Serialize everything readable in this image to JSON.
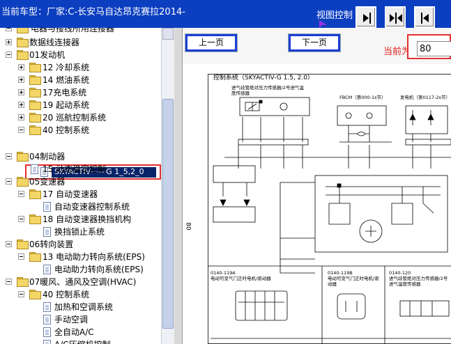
{
  "titlebar": {
    "title": "当前车型：厂家:C-长安马自达昂克赛拉2014-",
    "view_control_label": "视图控制",
    "colors": {
      "bar": "#0c3ec0",
      "arrow": "#9a30e0"
    }
  },
  "tree": {
    "row0_partial": "电器与接线所用连接器",
    "row1": "数据线连接器",
    "row2": "01发动机",
    "row3": "12 冷却系统",
    "row4": "14 燃油系统",
    "row5": "17充电系统",
    "row6": "19 起动系统",
    "row7": "20 巡航控制系统",
    "row8": "40 控制系统",
    "row9_selected": "SKYACTIV——G 1_5,2_0",
    "row10": "04制动器",
    "row11": "15 动态稳定控制",
    "row12": "05变速器",
    "row13": "17 自动变速器",
    "row14": "自动变速器控制系统",
    "row15": "18 自动变速器换挡机构",
    "row16": "换挡锁止系统",
    "row17": "06转向装置",
    "row18": "13 电动助力转向系统(EPS)",
    "row19": "电动助力转向系统(EPS)",
    "row20": "07暖风、通风及空调(HVAC)",
    "row21": "40 控制系统",
    "row22": "加热和空调系统",
    "row23": "手动空调",
    "row24": "全自动A/C",
    "row25_partial": "A/C压缩机控制"
  },
  "page_nav": {
    "prev_label": "上一页",
    "next_label": "下一页",
    "current_label": "当前为",
    "current_value": "80"
  },
  "diagram": {
    "title": "控制系统（SKYACTIV-G 1.5, 2.0）",
    "page_number": "80",
    "sensor_label": "进气歧管绝对压力传感器/2号进气温度传感器",
    "fbcm_label": "FBCM（第000-1s节）",
    "pcm_label": "发电机（第0117-2s节）",
    "bottom_connectors": [
      "0140-119A",
      "0140-119B",
      "0140-120"
    ],
    "bottom_captions": [
      "电动可变气门正时电机/驱动器",
      "电动可变气门正时电机/驱动器",
      "进气歧管绝对压力传感器/2号进气温度传感器"
    ]
  }
}
